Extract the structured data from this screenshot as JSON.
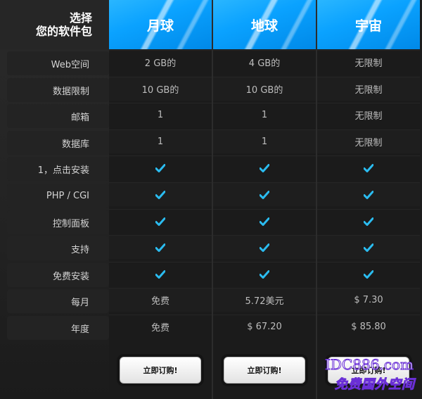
{
  "corner_title": {
    "line1": "选择",
    "line2": "您的软件包"
  },
  "plans": [
    {
      "name": "月球",
      "button": "立即订购!"
    },
    {
      "name": "地球",
      "button": "立即订购!"
    },
    {
      "name": "宇宙",
      "button": "立即订购!"
    }
  ],
  "features": [
    {
      "label": "Web空间",
      "values": [
        "2 GB的",
        "4 GB的",
        "无限制"
      ]
    },
    {
      "label": "数据限制",
      "values": [
        "10 GB的",
        "10 GB的",
        "无限制"
      ]
    },
    {
      "label": "邮箱",
      "values": [
        "1",
        "1",
        "无限制"
      ]
    },
    {
      "label": "数据库",
      "values": [
        "1",
        "1",
        "无限制"
      ]
    },
    {
      "label": "1，点击安装",
      "values": [
        "✓",
        "✓",
        "✓"
      ]
    },
    {
      "label": "PHP / CGI",
      "values": [
        "✓",
        "✓",
        "✓"
      ]
    },
    {
      "label": "控制面板",
      "values": [
        "✓",
        "✓",
        "✓"
      ]
    },
    {
      "label": "支持",
      "values": [
        "✓",
        "✓",
        "✓"
      ]
    },
    {
      "label": "免费安装",
      "values": [
        "✓",
        "✓",
        "✓"
      ]
    },
    {
      "label": "每月",
      "values": [
        "免费",
        "5.72美元",
        "$ 7.30"
      ]
    },
    {
      "label": "年度",
      "values": [
        "免费",
        "$ 67.20",
        "$ 85.80"
      ]
    }
  ],
  "check_color": "#2bbcf0",
  "header_color": "#0aa2ff",
  "watermark": {
    "line1": "IDC886.com",
    "line2": "免费国外空间"
  }
}
